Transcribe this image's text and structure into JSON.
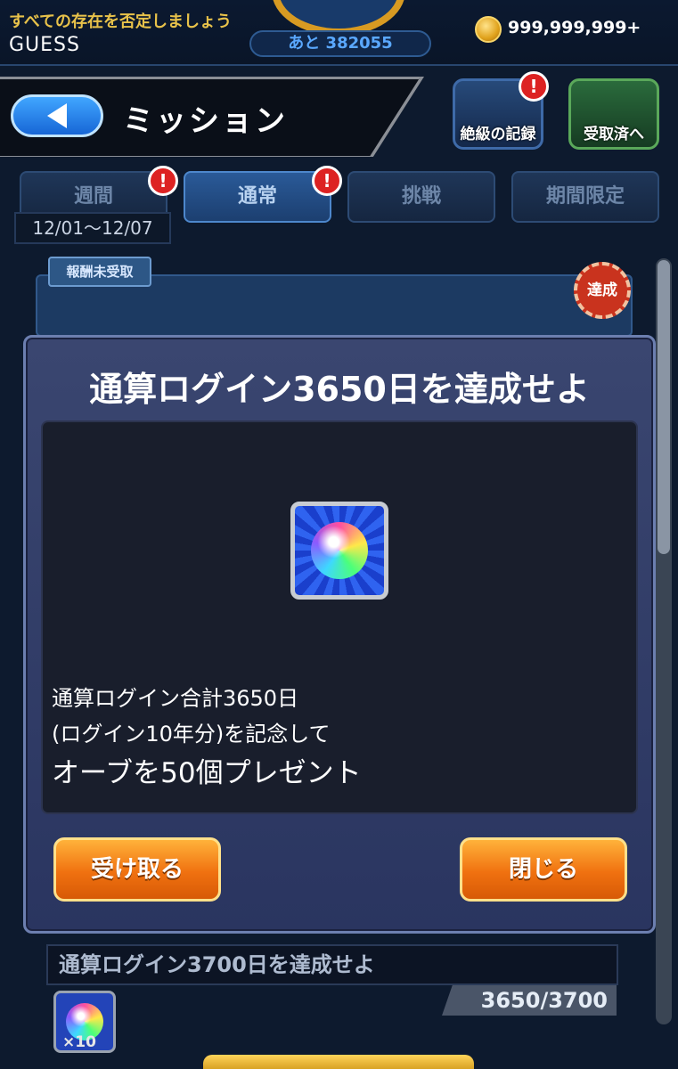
{
  "status": {
    "motto": "すべての存在を否定しましょう",
    "name": "GUESS",
    "exp_remaining": "あと 382055",
    "coins": "999,999,999+"
  },
  "header": {
    "title": "ミッション",
    "record_button": "絶級の記録",
    "received_button": "受取済へ",
    "badge_symbol": "!"
  },
  "tabs": [
    {
      "label": "週間"
    },
    {
      "label": "通常"
    },
    {
      "label": "挑戦"
    },
    {
      "label": "期間限定"
    }
  ],
  "week_range": "12/01〜12/07",
  "list": {
    "unclaimed_label": "報酬未受取",
    "achieved_stamp": "達成"
  },
  "modal": {
    "title": "通算ログイン3650日を達成せよ",
    "description_line1": "通算ログイン合計3650日",
    "description_line2": "(ログイン10年分)を記念して",
    "description_line3": "オーブを50個プレゼント",
    "receive_button": "受け取る",
    "close_button": "閉じる"
  },
  "next_mission": {
    "title": "通算ログイン3700日を達成せよ",
    "progress": "3650/3700",
    "reward_qty": "×10"
  }
}
